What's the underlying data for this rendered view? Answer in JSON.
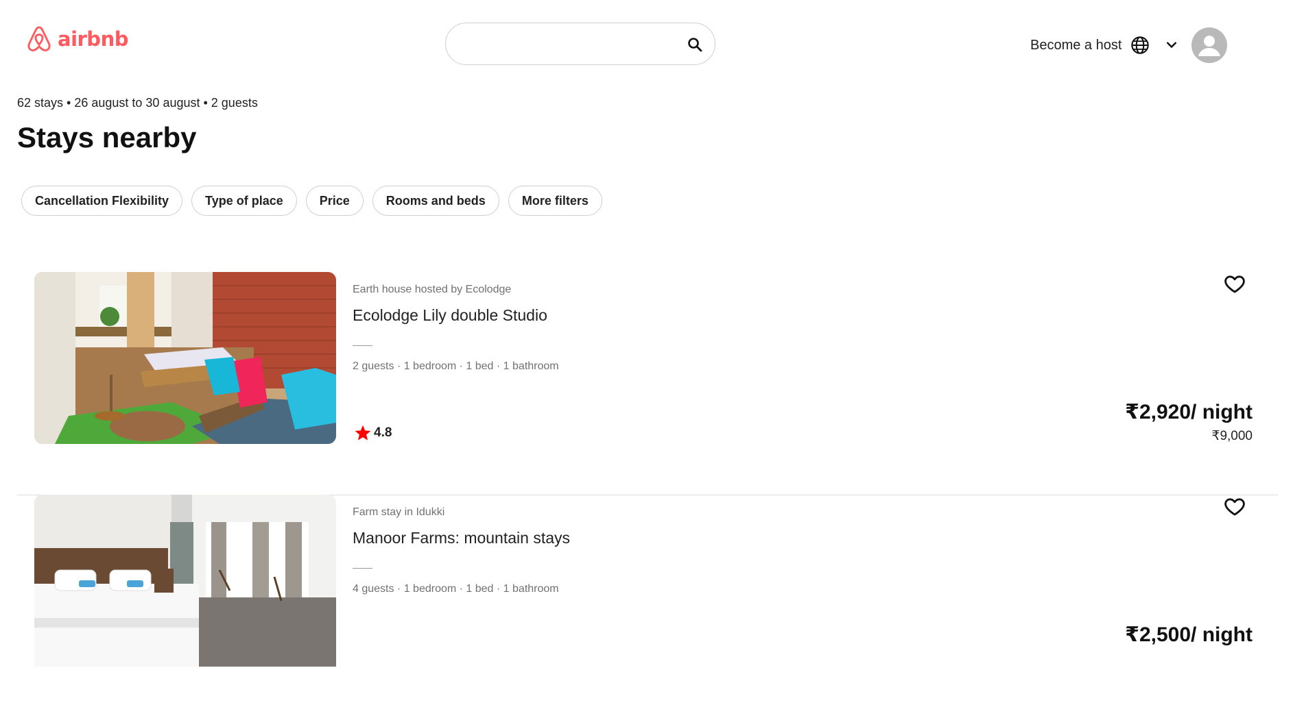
{
  "brand": {
    "name": "airbnb",
    "color": "#ff5a5f"
  },
  "search": {
    "value": "",
    "placeholder": "",
    "icon": "search-icon"
  },
  "nav": {
    "host_label": "Become a host",
    "globe_icon": "globe-icon",
    "menu_icon": "chevron-down-icon",
    "avatar_icon": "user-avatar-icon"
  },
  "summary": "62 stays • 26 august to 30 august • 2 guests",
  "page_title": "Stays nearby",
  "filters": [
    "Cancellation Flexibility",
    "Type of place",
    "Price",
    "Rooms and beds",
    "More filters"
  ],
  "listings": [
    {
      "subtitle": "Earth house hosted by Ecolodge",
      "name": "Ecolodge Lily double Studio",
      "details": "2 guests · 1 bedroom · 1 bed · 1 bathroom",
      "rating": "4.8",
      "price": "₹2,920/ night",
      "total": "₹9,000"
    },
    {
      "subtitle": "Farm stay in Idukki",
      "name": "Manoor Farms: mountain stays",
      "details": "4 guests · 1 bedroom · 1 bed · 1 bathroom",
      "rating": "",
      "price": "₹2,500/ night",
      "total": ""
    }
  ],
  "colors": {
    "star": "#ff0000",
    "divider": "#dddddd",
    "muted_text": "#717171"
  }
}
